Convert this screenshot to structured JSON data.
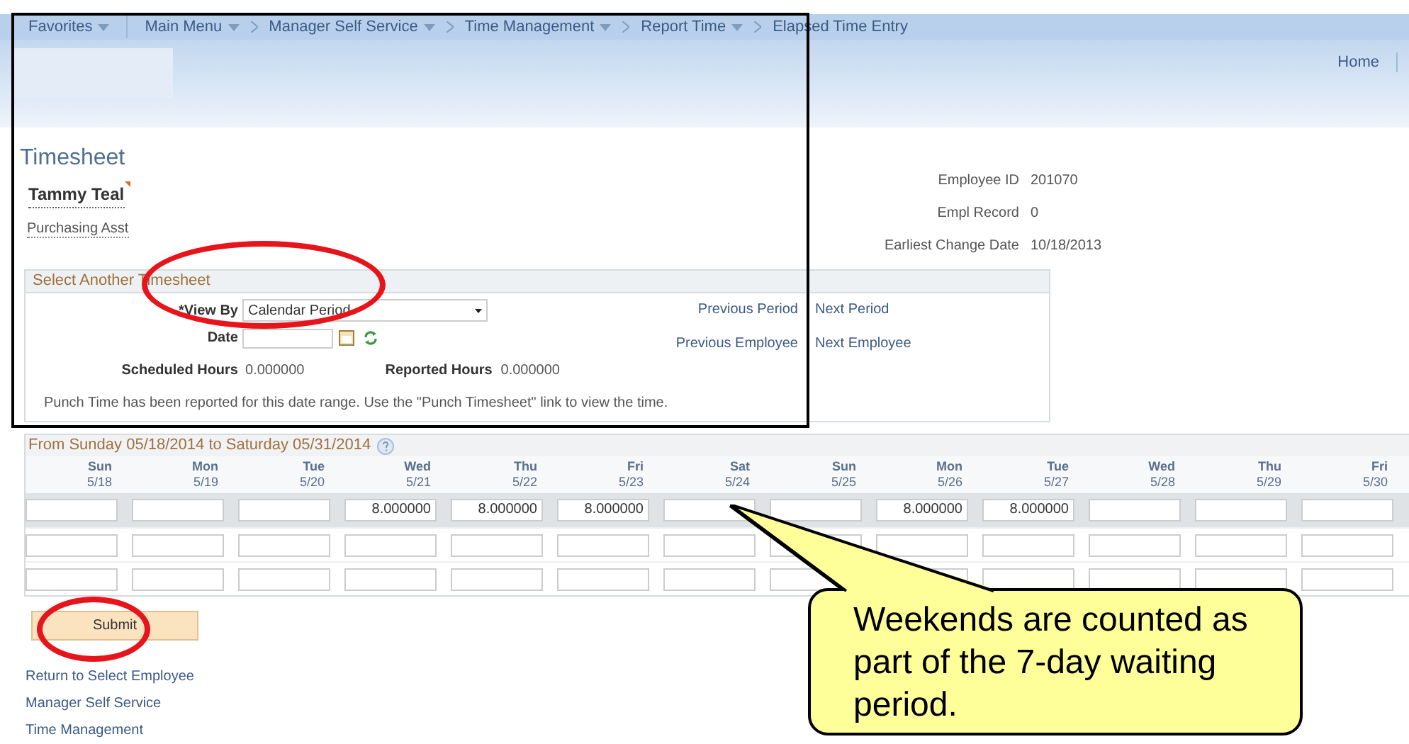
{
  "nav": {
    "favorites": "Favorites",
    "items": [
      {
        "label": "Main Menu",
        "dropdown": true
      },
      {
        "label": "Manager Self Service",
        "dropdown": true
      },
      {
        "label": "Time Management",
        "dropdown": true
      },
      {
        "label": "Report Time",
        "dropdown": true
      },
      {
        "label": "Elapsed Time Entry",
        "dropdown": false
      }
    ],
    "home": "Home"
  },
  "page_title": "Timesheet",
  "employee": {
    "name": "Tammy Teal",
    "job": "Purchasing Asst"
  },
  "info": [
    {
      "label": "Employee ID",
      "value": "201070"
    },
    {
      "label": "Empl Record",
      "value": "0"
    },
    {
      "label": "Earliest Change Date",
      "value": "10/18/2013"
    }
  ],
  "select_panel": {
    "title": "Select Another Timesheet",
    "view_by_label": "*View By",
    "view_by_value": "Calendar Period",
    "date_label": "Date",
    "links": [
      [
        "Previous Period",
        "Next Period"
      ],
      [
        "Previous Employee",
        "Next Employee"
      ]
    ],
    "scheduled_label": "Scheduled Hours",
    "scheduled_value": "0.000000",
    "reported_label": "Reported Hours",
    "reported_value": "0.000000",
    "note": "Punch Time has been reported for this date range. Use the \"Punch Timesheet\" link to view the time."
  },
  "grid": {
    "title": "From Sunday 05/18/2014 to Saturday 05/31/2014",
    "columns": [
      {
        "day": "Sun",
        "date": "5/18"
      },
      {
        "day": "Mon",
        "date": "5/19"
      },
      {
        "day": "Tue",
        "date": "5/20"
      },
      {
        "day": "Wed",
        "date": "5/21"
      },
      {
        "day": "Thu",
        "date": "5/22"
      },
      {
        "day": "Fri",
        "date": "5/23"
      },
      {
        "day": "Sat",
        "date": "5/24"
      },
      {
        "day": "Sun",
        "date": "5/25"
      },
      {
        "day": "Mon",
        "date": "5/26"
      },
      {
        "day": "Tue",
        "date": "5/27"
      },
      {
        "day": "Wed",
        "date": "5/28"
      },
      {
        "day": "Thu",
        "date": "5/29"
      },
      {
        "day": "Fri",
        "date": "5/30"
      }
    ],
    "rows": [
      {
        "shaded": true,
        "cells": [
          {},
          {},
          {},
          {
            "value": "8.000000"
          },
          {
            "value": "8.000000"
          },
          {
            "value": "8.000000"
          },
          {},
          {},
          {
            "value": "8.000000"
          },
          {
            "value": "8.000000"
          },
          {},
          {},
          {}
        ]
      },
      {
        "shaded": false,
        "cells": [
          {},
          {},
          {},
          {},
          {},
          {},
          {},
          {},
          {},
          {},
          {},
          {},
          {}
        ]
      },
      {
        "shaded": false,
        "cells": [
          {},
          {},
          {},
          {},
          {},
          {},
          {},
          {},
          {},
          {},
          {},
          {},
          {}
        ]
      }
    ]
  },
  "submit": "Submit",
  "bottom_links": [
    "Return to Select Employee",
    "Manager Self Service",
    "Time Management"
  ],
  "callout": {
    "text": "Weekends are counted as part of the 7-day waiting period."
  }
}
